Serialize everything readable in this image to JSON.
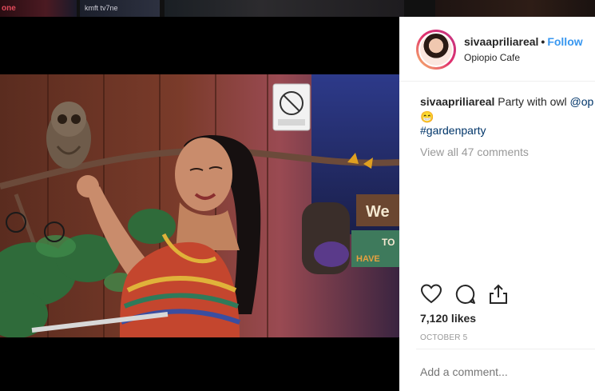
{
  "background": {
    "logo_text": "one",
    "channel_text": "kmft tv7ne"
  },
  "post": {
    "username": "sivaapriliareal",
    "follow_label": "Follow",
    "location": "Opiopio Cafe",
    "caption_user": "sivaapriliareal",
    "caption_text": "Party with owl",
    "caption_mention": "@op",
    "caption_emoji": "😁",
    "hashtag": "#gardenparty",
    "view_all_comments": "View all 47 comments",
    "likes": "7,120 likes",
    "date": "OCTOBER 5",
    "add_comment_placeholder": "Add a comment...",
    "photo_sign_text_1": "We",
    "photo_sign_text_2": "TO",
    "photo_sign_text_3": "HAVE"
  },
  "colors": {
    "link_blue": "#3897f0",
    "text": "#262626",
    "muted": "#999999",
    "hashtag": "#003569"
  },
  "icons": [
    "heart-icon",
    "comment-icon",
    "share-icon"
  ]
}
